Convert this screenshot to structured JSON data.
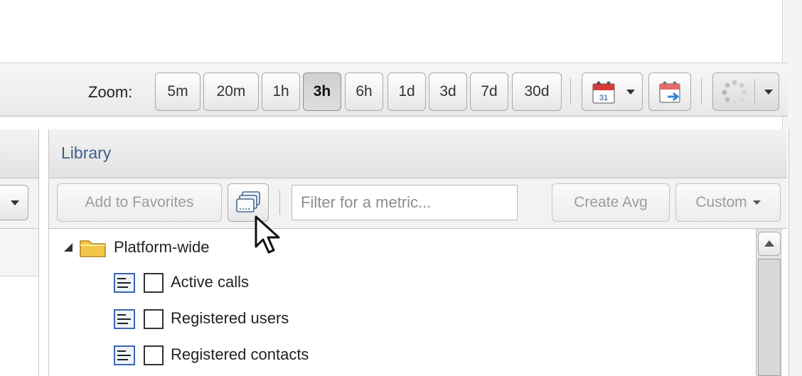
{
  "toolbar": {
    "zoom_label": "Zoom:",
    "zoom_options": [
      "5m",
      "20m",
      "1h",
      "3h",
      "6h",
      "1d",
      "3d",
      "7d",
      "30d"
    ],
    "selected_zoom": "3h",
    "calendar_day": "31"
  },
  "library": {
    "title": "Library",
    "add_favorites_label": "Add to Favorites",
    "filter_placeholder": "Filter for a metric...",
    "create_avg_label": "Create Avg",
    "custom_label": "Custom"
  },
  "tree": {
    "folder": {
      "label": "Platform-wide",
      "expanded": true
    },
    "items": [
      {
        "label": "Active calls",
        "checked": false
      },
      {
        "label": "Registered users",
        "checked": false
      },
      {
        "label": "Registered contacts",
        "checked": false
      }
    ]
  },
  "colors": {
    "library_title": "#3c5f87",
    "folder": "#f3c64a",
    "calendar_red": "#d83a3a"
  }
}
